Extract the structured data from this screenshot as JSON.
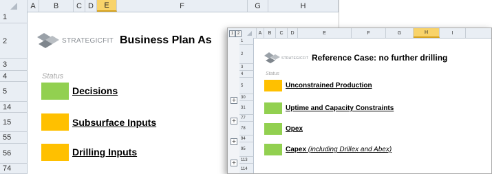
{
  "colors": {
    "green": "#92d050",
    "orange": "#ffc000",
    "header_bg": "#e9eef4",
    "selected_header": "#f8d36a"
  },
  "window_main": {
    "columns": [
      "A",
      "B",
      "C",
      "D",
      "E",
      "F",
      "G",
      "H"
    ],
    "selected_column": "E",
    "rows": [
      "1",
      "2",
      "3",
      "4",
      "5",
      "14",
      "15",
      "55",
      "56",
      "74"
    ],
    "logo_text": "STRATEGICFIT",
    "logo_icon": "strategicfit-logo-icon",
    "title": "Business Plan As",
    "status_label": "Status",
    "items": [
      {
        "label": "Decisions",
        "color": "green"
      },
      {
        "label": "Subsurface Inputs",
        "color": "orange"
      },
      {
        "label": "Drilling Inputs",
        "color": "orange"
      }
    ]
  },
  "window_detail": {
    "outline_levels": [
      "1",
      "2"
    ],
    "columns": [
      "A",
      "B",
      "C",
      "D",
      "E",
      "F",
      "G",
      "H",
      "I"
    ],
    "selected_column": "H",
    "rows": [
      "1",
      "2",
      "3",
      "4",
      "5",
      "30",
      "31",
      "77",
      "78",
      "94",
      "95",
      "113",
      "114"
    ],
    "logo_text": "STRATEGICFIT",
    "logo_icon": "strategicfit-logo-icon",
    "title": "Reference Case: no further drilling",
    "status_label": "Status",
    "expand_symbol": "+",
    "items": [
      {
        "label": "Unconstrained Production",
        "sub": "",
        "color": "orange"
      },
      {
        "label": "Uptime and Capacity Constraints",
        "sub": "",
        "color": "green"
      },
      {
        "label": "Opex",
        "sub": "",
        "color": "green"
      },
      {
        "label": "Capex",
        "sub": "(including Drillex and Abex)",
        "color": "green"
      }
    ]
  }
}
